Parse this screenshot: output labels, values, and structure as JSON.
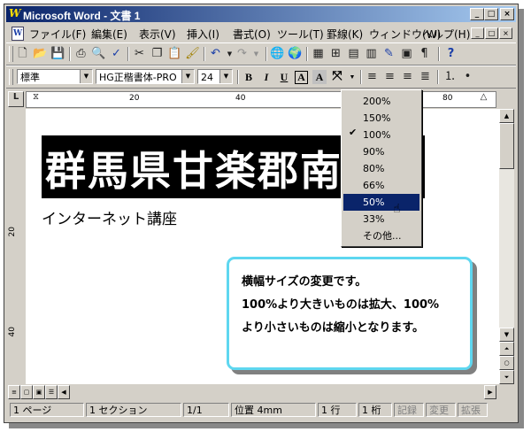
{
  "window": {
    "title": "Microsoft Word - 文書 1",
    "logo_letter": "W"
  },
  "title_buttons": [
    "_",
    "□",
    "×"
  ],
  "menubar": {
    "items": [
      "ファイル(F)",
      "編集(E)",
      "表示(V)",
      "挿入(I)",
      "書式(O)",
      "ツール(T)",
      "罫線(K)",
      "ウィンドウ(W)",
      "ヘルプ(H)"
    ],
    "mdi_buttons": [
      "_",
      "□",
      "×"
    ]
  },
  "format_bar": {
    "style": "標準",
    "font": "HG正楷書体-PRO",
    "size": "24"
  },
  "ruler": {
    "numbers": [
      "20",
      "40",
      "80"
    ]
  },
  "vruler": {
    "numbers": [
      "20",
      "40"
    ]
  },
  "document": {
    "banner_text": "群馬県甘楽郡南",
    "subtitle": "インターネット講座"
  },
  "zoom_dropdown": {
    "options": [
      "200%",
      "150%",
      "100%",
      "90%",
      "80%",
      "66%",
      "50%",
      "33%",
      "その他..."
    ],
    "checked": "100%",
    "selected": "50%"
  },
  "callout": {
    "lines": [
      "横幅サイズの変更です。",
      "100%より大きいものは拡大、100%",
      "より小さいものは縮小となります。"
    ],
    "border_color": "#5ed7f0"
  },
  "statusbar": {
    "page": "1 ページ",
    "section": "1 セクション",
    "pages": "1/1",
    "position": "位置 4mm",
    "line": "1 行",
    "column": "1 桁",
    "modes": [
      "記録",
      "変更",
      "拡張"
    ]
  }
}
